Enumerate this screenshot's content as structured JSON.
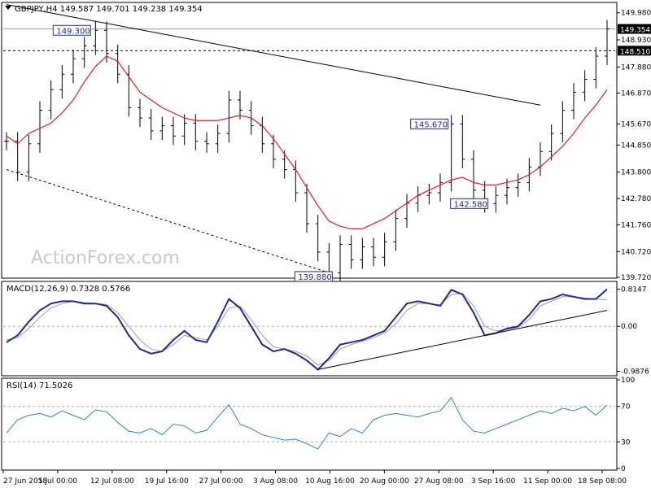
{
  "header": {
    "symbol_line": "GBPJPY,H4  149.587 149.701 149.238 149.354"
  },
  "watermark": "ActionForex.com",
  "colors": {
    "candle": "#000000",
    "ma": "#e41a1c",
    "macd": "#1f2a8c",
    "signal": "#9e9e9e",
    "rsi": "#2f7fd6",
    "grid": "#b0b0b0",
    "price_tag_bg": "#000000",
    "price_tag_fg": "#ffffff"
  },
  "chart_data": [
    {
      "type": "line",
      "panel": "price",
      "ylim": [
        139.72,
        150.35
      ],
      "yticks": [
        "149.980",
        "148.930",
        "147.880",
        "146.870",
        "145.670",
        "144.850",
        "143.800",
        "142.780",
        "141.760",
        "140.720",
        "139.720"
      ],
      "ytick_values": [
        149.98,
        148.93,
        147.88,
        146.87,
        145.67,
        144.85,
        143.8,
        142.78,
        141.76,
        140.72,
        139.72
      ],
      "current_price": {
        "label": "149.354",
        "value": 149.354
      },
      "level_line": {
        "label": "148.510",
        "value": 148.51
      },
      "xticks": [
        "27 Jun 2018",
        "5 Jul 00:00",
        "12 Jul 08:00",
        "19 Jul 16:00",
        "27 Jul 00:00",
        "3 Aug 08:00",
        "10 Aug 16:00",
        "20 Aug 00:00",
        "27 Aug 08:00",
        "3 Sep 16:00",
        "11 Sep 00:00",
        "18 Sep 08:00"
      ],
      "closes": [
        145.0,
        143.8,
        144.9,
        146.2,
        147.0,
        147.6,
        148.2,
        148.7,
        149.3,
        148.4,
        147.6,
        146.3,
        145.9,
        145.4,
        145.6,
        145.2,
        145.7,
        145.0,
        144.9,
        145.3,
        146.6,
        146.2,
        145.6,
        144.9,
        144.3,
        143.9,
        143.0,
        141.8,
        140.7,
        139.9,
        141.0,
        140.4,
        140.9,
        140.5,
        141.1,
        142.0,
        142.6,
        142.9,
        143.0,
        143.4,
        145.67,
        144.3,
        143.1,
        142.58,
        142.9,
        143.2,
        143.4,
        144.0,
        144.6,
        145.3,
        146.2,
        146.9,
        147.4,
        148.3,
        149.354
      ],
      "ma": [
        145.2,
        144.9,
        145.3,
        145.5,
        145.7,
        146.1,
        146.6,
        147.3,
        147.9,
        148.3,
        148.1,
        147.5,
        146.9,
        146.6,
        146.3,
        146.1,
        145.9,
        145.8,
        145.8,
        145.8,
        145.9,
        146.0,
        145.9,
        145.6,
        145.1,
        144.5,
        143.9,
        143.2,
        142.5,
        141.9,
        141.7,
        141.6,
        141.6,
        141.8,
        142.0,
        142.3,
        142.6,
        142.9,
        143.1,
        143.3,
        143.5,
        143.6,
        143.4,
        143.3,
        143.3,
        143.4,
        143.5,
        143.7,
        144.0,
        144.4,
        144.8,
        145.3,
        145.9,
        146.4,
        147.0
      ],
      "annotations": [
        {
          "label": "149.300",
          "value": 149.3
        },
        {
          "label": "145.670",
          "value": 145.67
        },
        {
          "label": "142.580",
          "value": 142.58
        },
        {
          "label": "139.880",
          "value": 139.88
        }
      ]
    },
    {
      "type": "line",
      "panel": "macd",
      "title": "MACD(12,26,9) 0.7328 0.5766",
      "ylim": [
        -1.05,
        0.95
      ],
      "yticks": [
        "0.8147",
        "0.00",
        "-0.9876"
      ],
      "ytick_values": [
        0.8147,
        0.0,
        -0.9876
      ],
      "macd": [
        -0.35,
        -0.2,
        0.1,
        0.35,
        0.5,
        0.55,
        0.55,
        0.5,
        0.5,
        0.45,
        0.2,
        -0.2,
        -0.5,
        -0.6,
        -0.55,
        -0.3,
        -0.1,
        -0.3,
        -0.35,
        0.1,
        0.6,
        0.4,
        0.0,
        -0.4,
        -0.55,
        -0.5,
        -0.6,
        -0.75,
        -0.95,
        -0.7,
        -0.4,
        -0.35,
        -0.3,
        -0.2,
        -0.1,
        0.2,
        0.5,
        0.55,
        0.5,
        0.45,
        0.8,
        0.7,
        0.3,
        -0.2,
        -0.15,
        -0.05,
        0.0,
        0.25,
        0.55,
        0.6,
        0.7,
        0.65,
        0.6,
        0.6,
        0.8147
      ],
      "signal": [
        -0.3,
        -0.25,
        -0.05,
        0.2,
        0.4,
        0.5,
        0.55,
        0.52,
        0.5,
        0.48,
        0.3,
        0.0,
        -0.3,
        -0.5,
        -0.55,
        -0.4,
        -0.2,
        -0.25,
        -0.3,
        0.0,
        0.4,
        0.45,
        0.15,
        -0.2,
        -0.45,
        -0.5,
        -0.55,
        -0.65,
        -0.85,
        -0.75,
        -0.5,
        -0.4,
        -0.33,
        -0.25,
        -0.15,
        0.05,
        0.35,
        0.5,
        0.5,
        0.47,
        0.7,
        0.72,
        0.45,
        0.0,
        -0.1,
        -0.07,
        -0.02,
        0.15,
        0.45,
        0.55,
        0.65,
        0.65,
        0.62,
        0.6,
        0.5766
      ],
      "trendline": {
        "from": [
          28,
          -0.95
        ],
        "to": [
          54,
          0.35
        ]
      }
    },
    {
      "type": "line",
      "panel": "rsi",
      "title": "RSI(14) 71.5026",
      "ylim": [
        0,
        100
      ],
      "yticks": [
        "100",
        "70",
        "30",
        "0"
      ],
      "ytick_values": [
        100,
        70,
        30,
        0
      ],
      "values": [
        40,
        55,
        60,
        62,
        58,
        65,
        60,
        55,
        66,
        64,
        52,
        42,
        40,
        45,
        38,
        50,
        48,
        40,
        43,
        58,
        72,
        50,
        45,
        38,
        35,
        32,
        33,
        28,
        22,
        40,
        36,
        45,
        40,
        55,
        60,
        62,
        60,
        58,
        62,
        65,
        80,
        55,
        42,
        40,
        45,
        50,
        55,
        60,
        65,
        62,
        68,
        65,
        70,
        60,
        71.5
      ]
    }
  ]
}
